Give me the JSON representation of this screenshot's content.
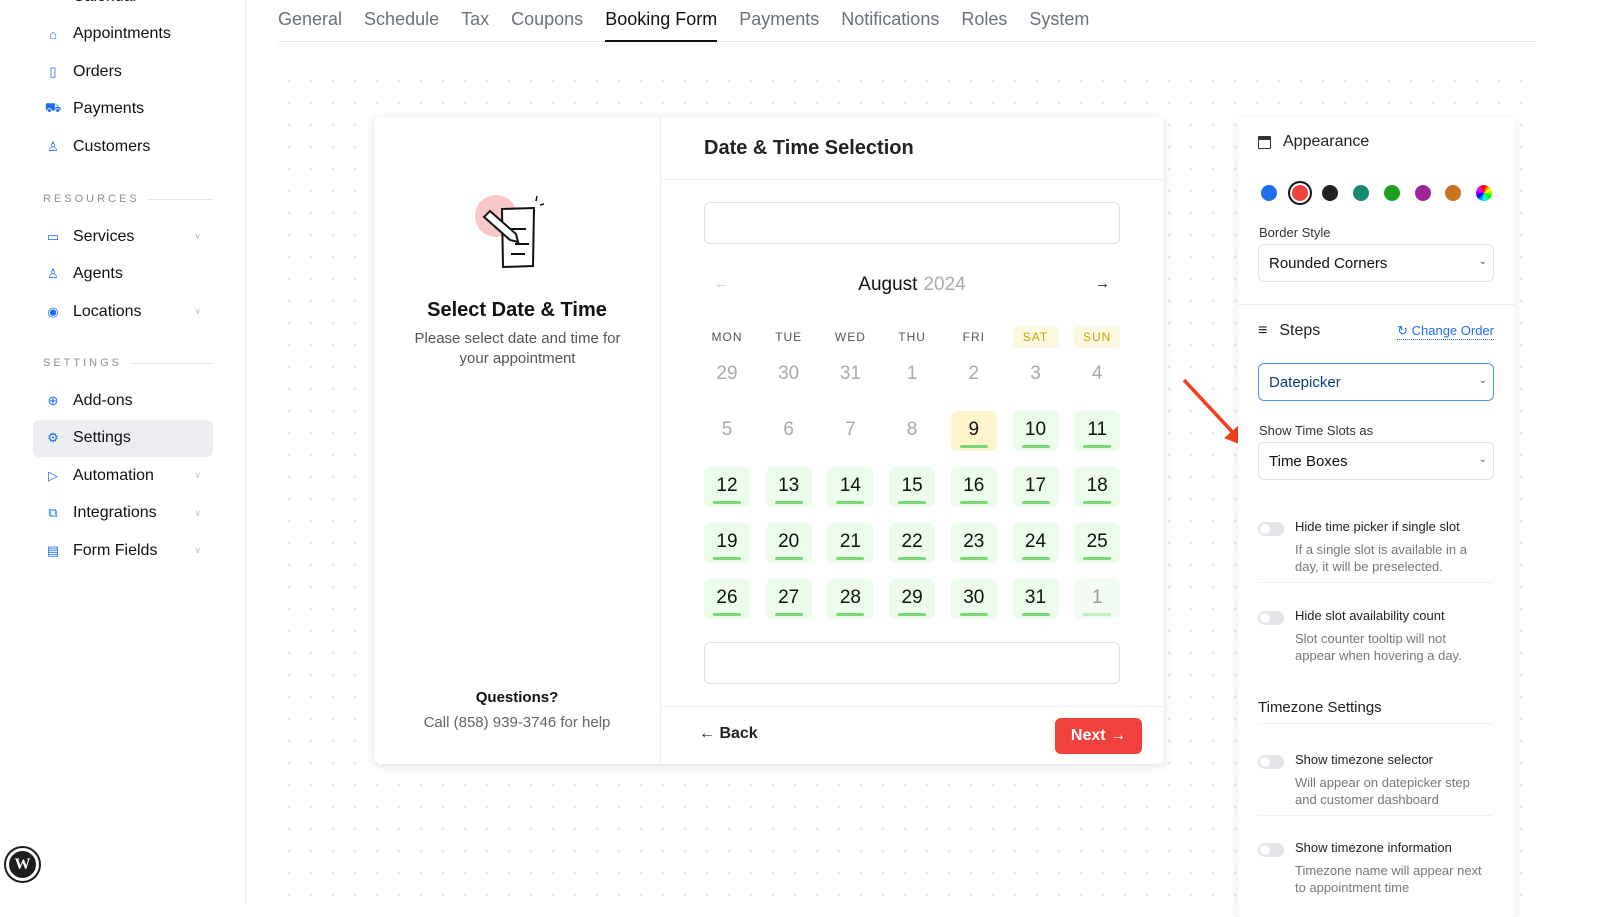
{
  "sidebar": {
    "top_items": [
      {
        "label": "Calendar",
        "icon": "calendar-icon"
      },
      {
        "label": "Appointments",
        "icon": "inbox-icon"
      },
      {
        "label": "Orders",
        "icon": "receipt-icon"
      },
      {
        "label": "Payments",
        "icon": "cart-icon"
      },
      {
        "label": "Customers",
        "icon": "user-icon"
      }
    ],
    "resources_label": "RESOURCES",
    "resources": [
      {
        "label": "Services",
        "icon": "folder-icon",
        "expandable": true
      },
      {
        "label": "Agents",
        "icon": "user-icon",
        "expandable": false
      },
      {
        "label": "Locations",
        "icon": "location-icon",
        "expandable": true
      }
    ],
    "settings_label": "SETTINGS",
    "settings": [
      {
        "label": "Add-ons",
        "icon": "plus-circle-icon",
        "expandable": false
      },
      {
        "label": "Settings",
        "icon": "gear-icon",
        "expandable": false,
        "active": true
      },
      {
        "label": "Automation",
        "icon": "play-icon",
        "expandable": true
      },
      {
        "label": "Integrations",
        "icon": "windows-icon",
        "expandable": true
      },
      {
        "label": "Form Fields",
        "icon": "form-icon",
        "expandable": true
      }
    ]
  },
  "tabs": [
    {
      "label": "General"
    },
    {
      "label": "Schedule"
    },
    {
      "label": "Tax"
    },
    {
      "label": "Coupons"
    },
    {
      "label": "Booking Form",
      "active": true
    },
    {
      "label": "Payments"
    },
    {
      "label": "Notifications"
    },
    {
      "label": "Roles"
    },
    {
      "label": "System"
    }
  ],
  "preview": {
    "left": {
      "title": "Select Date & Time",
      "description": "Please select date and time for your appointment",
      "questions_title": "Questions?",
      "questions_text": "Call (858) 939-3746 for help"
    },
    "step_title": "Date & Time Selection",
    "month": "August",
    "year": "2024",
    "weekdays": [
      "MON",
      "TUE",
      "WED",
      "THU",
      "FRI",
      "SAT",
      "SUN"
    ],
    "weeks": [
      [
        {
          "d": "29",
          "s": "off"
        },
        {
          "d": "30",
          "s": "off"
        },
        {
          "d": "31",
          "s": "off"
        },
        {
          "d": "1",
          "s": "off"
        },
        {
          "d": "2",
          "s": "off"
        },
        {
          "d": "3",
          "s": "off"
        },
        {
          "d": "4",
          "s": "off"
        }
      ],
      [
        {
          "d": "5",
          "s": "off"
        },
        {
          "d": "6",
          "s": "off"
        },
        {
          "d": "7",
          "s": "off"
        },
        {
          "d": "8",
          "s": "off"
        },
        {
          "d": "9",
          "s": "today"
        },
        {
          "d": "10",
          "s": "av"
        },
        {
          "d": "11",
          "s": "av"
        }
      ],
      [
        {
          "d": "12",
          "s": "av"
        },
        {
          "d": "13",
          "s": "av"
        },
        {
          "d": "14",
          "s": "av"
        },
        {
          "d": "15",
          "s": "av"
        },
        {
          "d": "16",
          "s": "av"
        },
        {
          "d": "17",
          "s": "av"
        },
        {
          "d": "18",
          "s": "av"
        }
      ],
      [
        {
          "d": "19",
          "s": "av"
        },
        {
          "d": "20",
          "s": "av"
        },
        {
          "d": "21",
          "s": "av"
        },
        {
          "d": "22",
          "s": "av"
        },
        {
          "d": "23",
          "s": "av"
        },
        {
          "d": "24",
          "s": "av"
        },
        {
          "d": "25",
          "s": "av"
        }
      ],
      [
        {
          "d": "26",
          "s": "av"
        },
        {
          "d": "27",
          "s": "av"
        },
        {
          "d": "28",
          "s": "av"
        },
        {
          "d": "29",
          "s": "av"
        },
        {
          "d": "30",
          "s": "av"
        },
        {
          "d": "31",
          "s": "av"
        },
        {
          "d": "1",
          "s": "dim"
        }
      ]
    ],
    "back_label": "Back",
    "next_label": "Next"
  },
  "panel": {
    "appearance_title": "Appearance",
    "colors": [
      "#1e6ff0",
      "#f0413e",
      "#222222",
      "#138a72",
      "#1ea01e",
      "#a0279a",
      "#c87522",
      "rainbow"
    ],
    "selected_color": "#f0413e",
    "border_style_label": "Border Style",
    "border_style_value": "Rounded Corners",
    "steps_title": "Steps",
    "change_order_label": "Change Order",
    "step_value": "Datepicker",
    "time_slots_label": "Show Time Slots as",
    "time_slots_value": "Time Boxes",
    "toggles1": [
      {
        "title": "Hide time picker if single slot",
        "desc": "If a single slot is available in a day, it will be preselected.",
        "on": false
      },
      {
        "title": "Hide slot availability count",
        "desc": "Slot counter tooltip will not appear when hovering a day.",
        "on": false
      }
    ],
    "timezone_title": "Timezone Settings",
    "toggles2": [
      {
        "title": "Show timezone selector",
        "desc": "Will appear on datepicker step and customer dashboard",
        "on": false
      },
      {
        "title": "Show timezone information",
        "desc": "Timezone name will appear next to appointment time",
        "on": false
      }
    ]
  },
  "annotation_arrow_color": "#f0401e"
}
